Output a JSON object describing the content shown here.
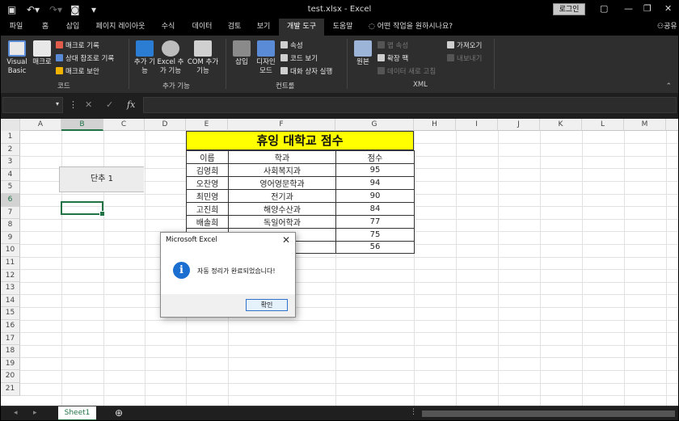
{
  "titlebar": {
    "title": "test.xlsx  -  Excel",
    "login": "로그인"
  },
  "tabs": [
    "파일",
    "홈",
    "삽입",
    "페이지 레이아웃",
    "수식",
    "데이터",
    "검토",
    "보기",
    "개발 도구",
    "도움말"
  ],
  "active_tab": "개발 도구",
  "tell_me": "어떤 작업을 원하시나요?",
  "share": "공유",
  "ribbon": {
    "code": {
      "visual_basic": "Visual Basic",
      "macro": "매크로",
      "record_macro": "매크로 기록",
      "relative_ref": "상대 참조로 기록",
      "macro_security": "매크로 보안",
      "label": "코드"
    },
    "addins": {
      "addins": "추가 기능",
      "excel_addins": "Excel 추가 기능",
      "com_addins": "COM 추가 기능",
      "label": "추가 기능"
    },
    "controls": {
      "insert": "삽입",
      "design_mode": "디자인 모드",
      "properties": "속성",
      "view_code": "코드 보기",
      "run_dialog": "대화 상자 실행",
      "label": "컨트롤"
    },
    "xml": {
      "source": "원본",
      "map_props": "맵 속성",
      "expansion_packs": "확장 팩",
      "refresh_data": "데이터 새로 고침",
      "import": "가져오기",
      "export": "내보내기",
      "label": "XML"
    }
  },
  "formula_bar": {
    "namebox": "",
    "formula": "",
    "fx": "fx"
  },
  "columns": [
    "A",
    "B",
    "C",
    "D",
    "E",
    "F",
    "G",
    "H",
    "I",
    "J",
    "K",
    "L",
    "M"
  ],
  "selected_column": "B",
  "rows": [
    "1",
    "2",
    "3",
    "4",
    "5",
    "6",
    "7",
    "8",
    "9",
    "10",
    "11",
    "12",
    "13",
    "14",
    "15",
    "16",
    "17",
    "18",
    "19",
    "20",
    "21"
  ],
  "selected_row": "6",
  "sheet": {
    "title": "휴잉 대학교 점수",
    "headers": [
      "이름",
      "학과",
      "점수"
    ],
    "records": [
      [
        "김영희",
        "사회복지과",
        "95"
      ],
      [
        "오찬영",
        "영어영문학과",
        "94"
      ],
      [
        "최민영",
        "전기과",
        "90"
      ],
      [
        "고진희",
        "해양수산과",
        "84"
      ],
      [
        "배솔희",
        "독일어학과",
        "77"
      ],
      [
        "",
        "",
        "75"
      ],
      [
        "",
        "",
        "56"
      ]
    ]
  },
  "shape_button": "단추 1",
  "dialog": {
    "title": "Microsoft Excel",
    "message": "자동 정리가 완료되었습니다!",
    "ok": "확인",
    "close": "✕",
    "icon": "i"
  },
  "sheet_tabs": [
    "Sheet1"
  ],
  "colors": {
    "accent": "#217346",
    "title_fill": "#ffff00",
    "info_icon": "#1a6fd0"
  }
}
